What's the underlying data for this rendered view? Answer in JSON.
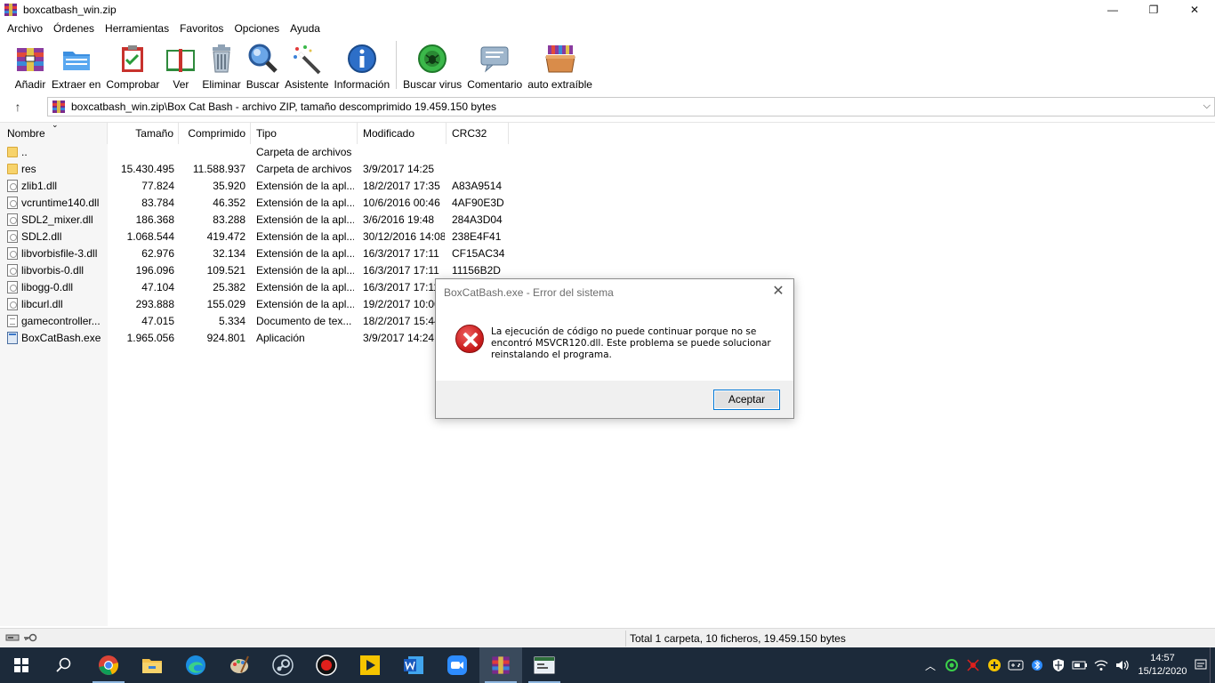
{
  "window": {
    "title": "boxcatbash_win.zip",
    "controls": {
      "minimize": "—",
      "maximize": "❐",
      "close": "✕"
    }
  },
  "menu": [
    "Archivo",
    "Órdenes",
    "Herramientas",
    "Favoritos",
    "Opciones",
    "Ayuda"
  ],
  "toolbar": {
    "add": "Añadir",
    "extract": "Extraer en",
    "test": "Comprobar",
    "view": "Ver",
    "delete": "Eliminar",
    "find": "Buscar",
    "wizard": "Asistente",
    "info": "Información",
    "virus": "Buscar virus",
    "comment": "Comentario",
    "sfx": "auto extraíble"
  },
  "address": {
    "path": "boxcatbash_win.zip\\Box Cat Bash - archivo ZIP, tamaño descomprimido 19.459.150 bytes"
  },
  "columns": {
    "name": "Nombre",
    "size": "Tamaño",
    "packed": "Comprimido",
    "type": "Tipo",
    "modified": "Modificado",
    "crc": "CRC32"
  },
  "files": [
    {
      "name": "..",
      "size": "",
      "packed": "",
      "type": "Carpeta de archivos",
      "modified": "",
      "crc": "",
      "icon": "folder"
    },
    {
      "name": "res",
      "size": "15.430.495",
      "packed": "11.588.937",
      "type": "Carpeta de archivos",
      "modified": "3/9/2017 14:25",
      "crc": "",
      "icon": "folder"
    },
    {
      "name": "zlib1.dll",
      "size": "77.824",
      "packed": "35.920",
      "type": "Extensión de la apl...",
      "modified": "18/2/2017 17:35",
      "crc": "A83A9514",
      "icon": "dll"
    },
    {
      "name": "vcruntime140.dll",
      "size": "83.784",
      "packed": "46.352",
      "type": "Extensión de la apl...",
      "modified": "10/6/2016 00:46",
      "crc": "4AF90E3D",
      "icon": "dll"
    },
    {
      "name": "SDL2_mixer.dll",
      "size": "186.368",
      "packed": "83.288",
      "type": "Extensión de la apl...",
      "modified": "3/6/2016 19:48",
      "crc": "284A3D04",
      "icon": "dll"
    },
    {
      "name": "SDL2.dll",
      "size": "1.068.544",
      "packed": "419.472",
      "type": "Extensión de la apl...",
      "modified": "30/12/2016 14:08",
      "crc": "238E4F41",
      "icon": "dll"
    },
    {
      "name": "libvorbisfile-3.dll",
      "size": "62.976",
      "packed": "32.134",
      "type": "Extensión de la apl...",
      "modified": "16/3/2017 17:11",
      "crc": "CF15AC34",
      "icon": "dll"
    },
    {
      "name": "libvorbis-0.dll",
      "size": "196.096",
      "packed": "109.521",
      "type": "Extensión de la apl...",
      "modified": "16/3/2017 17:11",
      "crc": "11156B2D",
      "icon": "dll"
    },
    {
      "name": "libogg-0.dll",
      "size": "47.104",
      "packed": "25.382",
      "type": "Extensión de la apl...",
      "modified": "16/3/2017 17:11",
      "crc": "",
      "icon": "dll"
    },
    {
      "name": "libcurl.dll",
      "size": "293.888",
      "packed": "155.029",
      "type": "Extensión de la apl...",
      "modified": "19/2/2017 10:00",
      "crc": "",
      "icon": "dll"
    },
    {
      "name": "gamecontroller...",
      "size": "47.015",
      "packed": "5.334",
      "type": "Documento de tex...",
      "modified": "18/2/2017 15:44",
      "crc": "",
      "icon": "doc"
    },
    {
      "name": "BoxCatBash.exe",
      "size": "1.965.056",
      "packed": "924.801",
      "type": "Aplicación",
      "modified": "3/9/2017 14:24",
      "crc": "",
      "icon": "exe"
    }
  ],
  "status": {
    "text": "Total 1 carpeta, 10 ficheros, 19.459.150 bytes"
  },
  "dialog": {
    "title": "BoxCatBash.exe - Error del sistema",
    "message": "La ejecución de código no puede continuar porque no se encontró MSVCR120.dll. Este problema se puede solucionar reinstalando el programa.",
    "button": "Aceptar",
    "close": "✕"
  },
  "taskbar": {
    "time": "14:57",
    "date": "15/12/2020"
  }
}
